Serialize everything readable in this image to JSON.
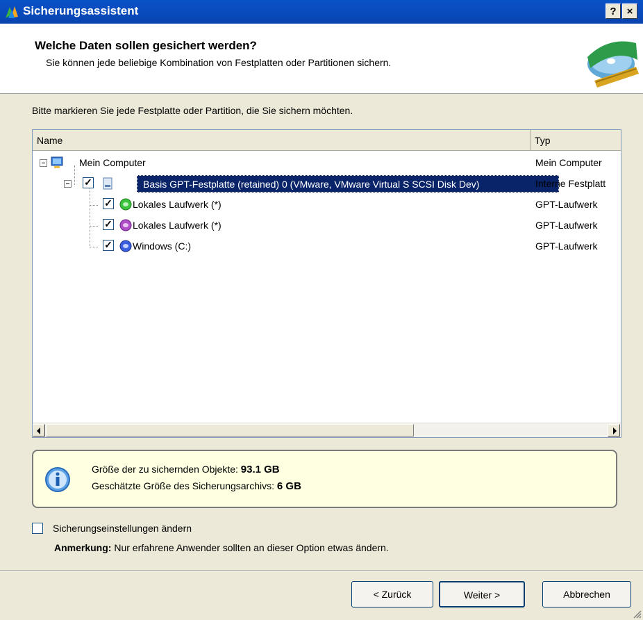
{
  "window": {
    "title": "Sicherungsassistent",
    "help_button": "?",
    "close_button": "×"
  },
  "header": {
    "heading": "Welche Daten sollen gesichert werden?",
    "subheading": "Sie können jede beliebige Kombination von Festplatten oder Partitionen sichern."
  },
  "instruction": "Bitte markieren Sie jede Festplatte oder Partition, die Sie sichern möchten.",
  "list": {
    "columns": [
      "Name",
      "Typ"
    ],
    "rows": [
      {
        "label": "Mein Computer",
        "type": "Mein Computer"
      },
      {
        "label": "Basis GPT-Festplatte (retained) 0 (VMware, VMware Virtual S SCSI Disk Dev)",
        "type": "Interne Festplatt",
        "checked": true
      },
      {
        "label": "Lokales Laufwerk (*)",
        "type": "GPT-Laufwerk",
        "checked": true
      },
      {
        "label": "Lokales Laufwerk (*)",
        "type": "GPT-Laufwerk",
        "checked": true
      },
      {
        "label": "Windows (C:)",
        "type": "GPT-Laufwerk",
        "checked": true
      }
    ]
  },
  "info": {
    "size_label": "Größe der zu sichernden Objekte:",
    "size_value": "93.1 GB",
    "archive_label": "Geschätzte Größe des Sicherungsarchivs:",
    "archive_value": "6 GB"
  },
  "options": {
    "change_settings_label": "Sicherungseinstellungen ändern",
    "change_settings_checked": false,
    "note_label": "Anmerkung:",
    "note_text": "Nur erfahrene Anwender sollten an dieser Option etwas ändern."
  },
  "buttons": {
    "back": "< Zurück",
    "next": "Weiter >",
    "cancel": "Abbrechen"
  },
  "colors": {
    "titlebar": "#0a52c8",
    "selection": "#0a246a",
    "info_bg": "#ffffe1",
    "dialog_bg": "#ece9d8"
  }
}
